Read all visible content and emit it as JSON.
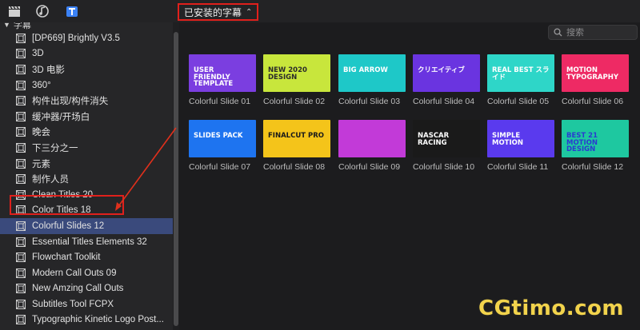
{
  "toolbar": {
    "icons": [
      "clapper-icon",
      "music-icon",
      "titles-icon"
    ],
    "filter_label": "已安装的字幕"
  },
  "sidebar": {
    "root_label": "字幕",
    "items": [
      {
        "label": "[DP669] Brightly V3.5"
      },
      {
        "label": "3D"
      },
      {
        "label": "3D 电影"
      },
      {
        "label": "360°"
      },
      {
        "label": "构件出现/构件消失"
      },
      {
        "label": "缓冲器/开场白"
      },
      {
        "label": "晚会"
      },
      {
        "label": "下三分之一"
      },
      {
        "label": "元素"
      },
      {
        "label": "制作人员"
      },
      {
        "label": "Clean Titles 20"
      },
      {
        "label": "Color Titles 18"
      },
      {
        "label": "Colorful Slides 12"
      },
      {
        "label": "Essential Titles Elements 32"
      },
      {
        "label": "Flowchart Toolkit"
      },
      {
        "label": "Modern Call Outs 09"
      },
      {
        "label": "New Amzing Call Outs"
      },
      {
        "label": "Subtitles Tool FCPX"
      },
      {
        "label": "Typographic Kinetic Logo Post..."
      }
    ],
    "selected_index": 12
  },
  "search": {
    "placeholder": "搜索"
  },
  "tiles": [
    {
      "caption": "Colorful Slide 01",
      "bg": "#7b3ee0",
      "text": "USER FRIENDLY TEMPLATE",
      "fg": "#ffffff"
    },
    {
      "caption": "Colorful Slide 02",
      "bg": "#c8e63c",
      "text": "NEW 2020 DESIGN",
      "fg": "#2a2a2a"
    },
    {
      "caption": "Colorful Slide 03",
      "bg": "#1ec8c8",
      "text": "BIG ARROW",
      "fg": "#ffffff"
    },
    {
      "caption": "Colorful Slide 04",
      "bg": "#6a34e0",
      "text": "クリエイティブ",
      "fg": "#ffffff"
    },
    {
      "caption": "Colorful Slide 05",
      "bg": "#2ed6c8",
      "text": "REAL BEST スライド",
      "fg": "#ffffff"
    },
    {
      "caption": "Colorful Slide 06",
      "bg": "#ee2a64",
      "text": "MOTION TYPOGRAPHY",
      "fg": "#ffffff"
    },
    {
      "caption": "Colorful Slide 07",
      "bg": "#1e74f0",
      "text": "SLIDES PACK",
      "fg": "#ffffff"
    },
    {
      "caption": "Colorful Slide 08",
      "bg": "#f4c41a",
      "text": "FINALCUT PRO",
      "fg": "#1a1a1a"
    },
    {
      "caption": "Colorful Slide 09",
      "bg": "#c23ad8",
      "text": "",
      "fg": "#ffffff"
    },
    {
      "caption": "Colorful Slide 10",
      "bg": "#1a1a1a",
      "text": "NASCAR RACING",
      "fg": "#ffffff"
    },
    {
      "caption": "Colorful Slide 11",
      "bg": "#5a3aee",
      "text": "SIMPLE MOTION",
      "fg": "#ffffff"
    },
    {
      "caption": "Colorful Slide 12",
      "bg": "#1ec8a0",
      "text": "BEST 21 MOTION DESIGN",
      "fg": "#2a3ad0"
    }
  ],
  "watermark": "CGtimo.com",
  "colors": {
    "highlight_box": "#e0201c",
    "selection": "#3a4a7c",
    "arrow": "#e0301c"
  }
}
